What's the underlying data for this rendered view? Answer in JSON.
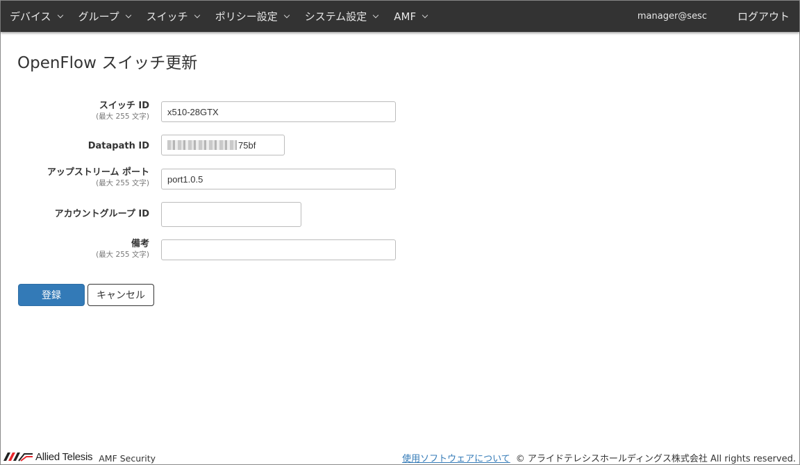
{
  "nav": {
    "items": [
      {
        "label": "デバイス"
      },
      {
        "label": "グループ"
      },
      {
        "label": "スイッチ"
      },
      {
        "label": "ポリシー設定"
      },
      {
        "label": "システム設定"
      },
      {
        "label": "AMF"
      }
    ],
    "user": "manager@sesc",
    "logout": "ログアウト"
  },
  "page": {
    "title": "OpenFlow スイッチ更新"
  },
  "form": {
    "switch_id": {
      "label": "スイッチ ID",
      "hint": "(最大 255 文字)",
      "value": "x510-28GTX"
    },
    "datapath_id": {
      "label": "Datapath ID",
      "value_suffix": "75bf"
    },
    "upstream_port": {
      "label": "アップストリーム ポート",
      "hint": "(最大 255 文字)",
      "value": "port1.0.5"
    },
    "account_group_id": {
      "label": "アカウントグループ ID",
      "value": ""
    },
    "remarks": {
      "label": "備考",
      "hint": "(最大 255 文字)",
      "value": ""
    }
  },
  "buttons": {
    "submit": "登録",
    "cancel": "キャンセル"
  },
  "footer": {
    "logo_text": "Allied Telesis",
    "product": "AMF Security",
    "software_link": "使用ソフトウェアについて",
    "copyright": "© アライドテレシスホールディングス株式会社 All rights reserved."
  },
  "colors": {
    "navbar": "#333333",
    "primary": "#337ab7",
    "logo_red": "#e8262c"
  }
}
